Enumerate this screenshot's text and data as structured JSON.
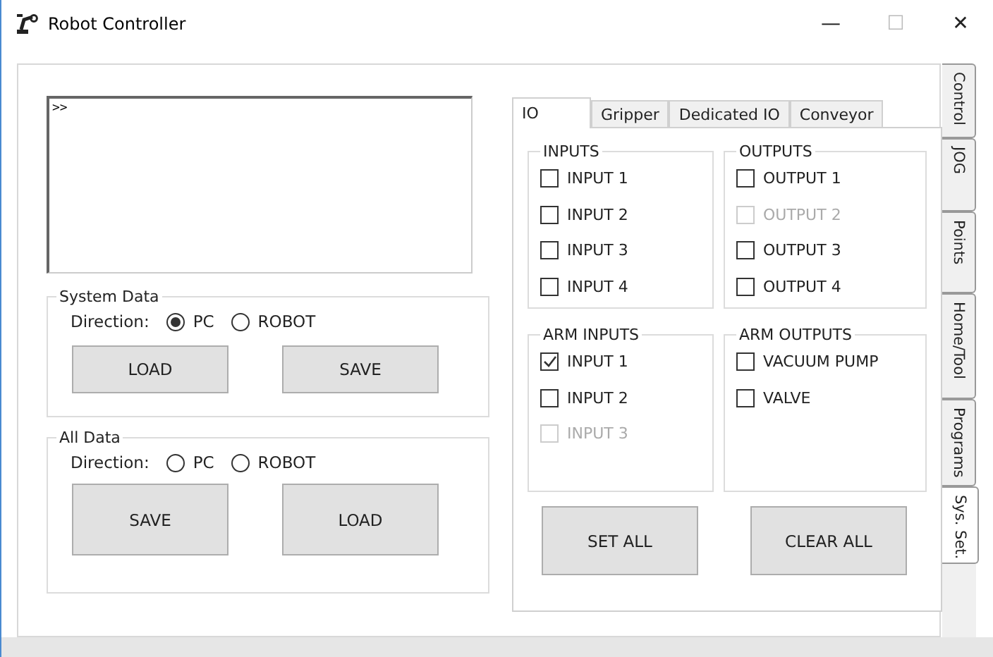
{
  "window": {
    "title": "Robot Controller",
    "controls": [
      "—",
      "☐",
      "✕"
    ]
  },
  "console": {
    "value": ">>"
  },
  "data_groups": [
    {
      "title": "System Data",
      "direction_label": "Direction:",
      "options": [
        {
          "label": "PC",
          "selected": true
        },
        {
          "label": "ROBOT",
          "selected": false
        }
      ],
      "buttons": [
        "LOAD",
        "SAVE"
      ]
    },
    {
      "title": "All Data",
      "direction_label": "Direction:",
      "options": [
        {
          "label": "PC",
          "selected": false
        },
        {
          "label": "ROBOT",
          "selected": false
        }
      ],
      "buttons": [
        "SAVE",
        "LOAD"
      ]
    }
  ],
  "tabs": [
    {
      "label": "IO",
      "selected": true
    },
    {
      "label": "Gripper",
      "selected": false
    },
    {
      "label": "Dedicated IO",
      "selected": false
    },
    {
      "label": "Conveyor",
      "selected": false
    }
  ],
  "io_groups": [
    {
      "title": "INPUTS",
      "items": [
        {
          "label": "INPUT 1",
          "checked": false,
          "disabled": false
        },
        {
          "label": "INPUT 2",
          "checked": false,
          "disabled": false
        },
        {
          "label": "INPUT 3",
          "checked": false,
          "disabled": false
        },
        {
          "label": "INPUT 4",
          "checked": false,
          "disabled": false
        }
      ]
    },
    {
      "title": "OUTPUTS",
      "items": [
        {
          "label": "OUTPUT 1",
          "checked": false,
          "disabled": false
        },
        {
          "label": "OUTPUT 2",
          "checked": false,
          "disabled": true
        },
        {
          "label": "OUTPUT 3",
          "checked": false,
          "disabled": false
        },
        {
          "label": "OUTPUT 4",
          "checked": false,
          "disabled": false
        }
      ]
    },
    {
      "title": "ARM INPUTS",
      "items": [
        {
          "label": "INPUT 1",
          "checked": true,
          "disabled": false
        },
        {
          "label": "INPUT 2",
          "checked": false,
          "disabled": false
        },
        {
          "label": "INPUT 3",
          "checked": false,
          "disabled": true
        }
      ]
    },
    {
      "title": "ARM OUTPUTS",
      "items": [
        {
          "label": "VACUUM PUMP",
          "checked": false,
          "disabled": false
        },
        {
          "label": "VALVE",
          "checked": false,
          "disabled": false
        }
      ]
    }
  ],
  "io_buttons": [
    "SET ALL",
    "CLEAR ALL"
  ],
  "side_tabs": [
    {
      "label": "Control",
      "selected": false
    },
    {
      "label": "JOG",
      "selected": false
    },
    {
      "label": "Points",
      "selected": false
    },
    {
      "label": "Home/Tool",
      "selected": false
    },
    {
      "label": "Programs",
      "selected": false
    },
    {
      "label": "Sys. Set.",
      "selected": true
    }
  ]
}
